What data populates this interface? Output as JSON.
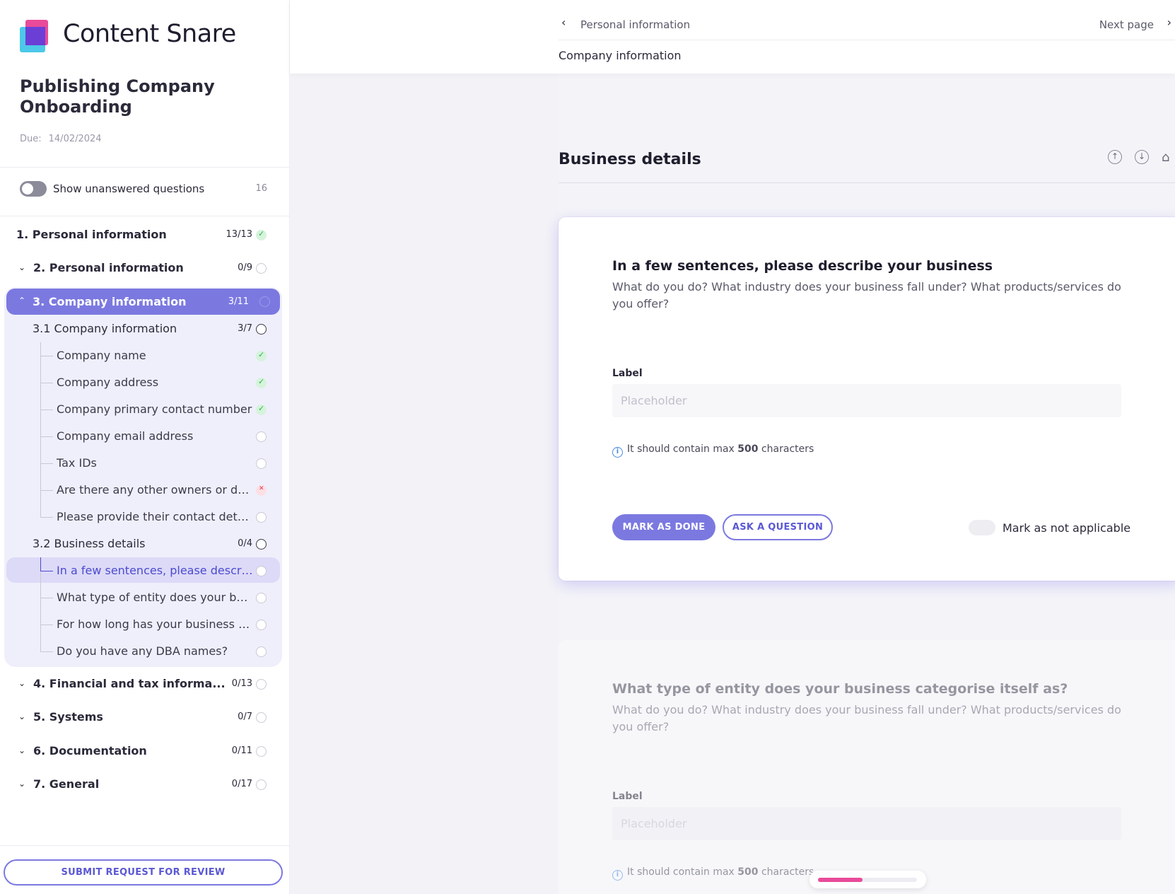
{
  "brand": {
    "name": "Content Snare",
    "colors": {
      "accent": "#7b79e0",
      "pink": "#e94b9a",
      "cyan": "#4cc9e8",
      "purple": "#6b3fd6"
    }
  },
  "project": {
    "title": "Publishing Company Onboarding",
    "due_label": "Due:",
    "due_date": "14/02/2024"
  },
  "filter": {
    "label": "Show unanswered questions",
    "count": "16"
  },
  "nav": {
    "s1": {
      "label": "1. Personal information",
      "count": "13/13"
    },
    "s2": {
      "label": "2. Personal information",
      "count": "0/9"
    },
    "s3": {
      "label": "3. Company information",
      "count": "3/11"
    },
    "s3_1": {
      "label": "3.1 Company information",
      "count": "3/7",
      "items": [
        "Company name",
        "Company address",
        "Company primary contact number",
        "Company email address",
        "Tax IDs",
        "Are there any other owners or directors?",
        "Please provide their contact details"
      ]
    },
    "s3_2": {
      "label": "3.2 Business details",
      "count": "0/4",
      "items": [
        "In a few sentences, please describe your business",
        "What type of entity does your business categorise itself as?",
        "For how long has your business been operating?",
        "Do you have any DBA names?"
      ]
    },
    "s4": {
      "label": "4. Financial and tax informa...",
      "count": "0/13"
    },
    "s5": {
      "label": "5. Systems",
      "count": "0/7"
    },
    "s6": {
      "label": "6. Documentation",
      "count": "0/11"
    },
    "s7": {
      "label": "7. General",
      "count": "0/17"
    }
  },
  "submit_label": "SUBMIT REQUEST FOR REVIEW",
  "topbar": {
    "prev": "Personal information",
    "next": "Next page",
    "current": "Company information"
  },
  "section": {
    "title": "Business details"
  },
  "question1": {
    "title": "In a few sentences, please describe your business",
    "description": "What do you do? What industry does your business fall under? What products/services do you offer?",
    "field_label": "Label",
    "placeholder": "Placeholder",
    "hint_pre": "It should contain max ",
    "hint_num": "500",
    "hint_post": " characters",
    "done_label": "MARK AS DONE",
    "ask_label": "ASK A QUESTION",
    "na_label": "Mark as not applicable"
  },
  "question2": {
    "title": "What type of entity does your business categorise itself as?",
    "description": "What do you do? What industry does your business fall under? What products/services do you offer?",
    "field_label": "Label",
    "placeholder": "Placeholder",
    "hint_pre": "It should contain max ",
    "hint_num": "500",
    "hint_post": " characters"
  },
  "progress": {
    "fraction": 0.45
  }
}
